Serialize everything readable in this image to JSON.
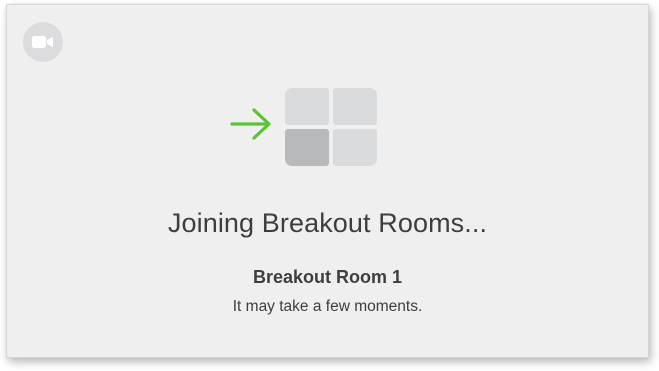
{
  "dialog": {
    "title": "Joining Breakout Rooms...",
    "room_name": "Breakout Room 1",
    "message": "It may take a few moments."
  },
  "icons": {
    "camera": "video-camera-icon",
    "arrow": "arrow-right-icon",
    "grid": "breakout-rooms-grid-icon"
  },
  "colors": {
    "background": "#efeff0",
    "arrow": "#5cc23a",
    "tile": "#dadbdd",
    "tile_active": "#b8b9bb",
    "text": "#3e3e40"
  }
}
